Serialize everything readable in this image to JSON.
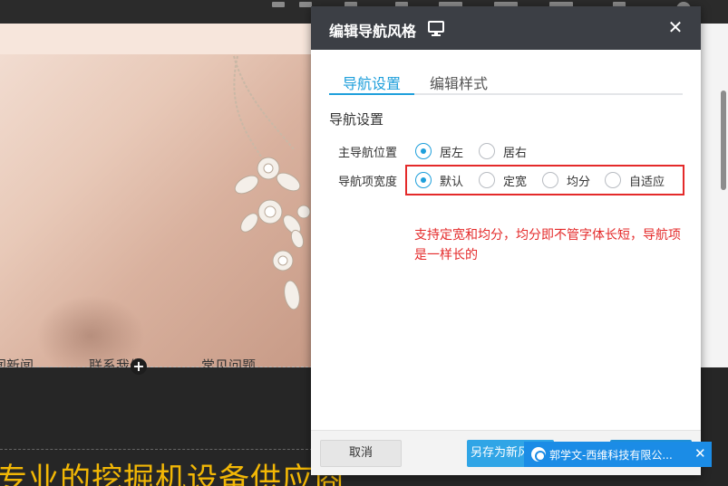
{
  "website": {
    "nav_items": [
      "闻新闻",
      "联系我们",
      "常见问题"
    ],
    "add_symbol": "+",
    "slogan": "专业的挖掘机设备供应商"
  },
  "modal": {
    "title": "编辑导航风格",
    "close_symbol": "✕",
    "tabs": [
      {
        "label": "导航设置",
        "active": true
      },
      {
        "label": "编辑样式",
        "active": false
      }
    ],
    "section_title": "导航设置",
    "position_row": {
      "label": "主导航位置",
      "options": [
        {
          "label": "居左",
          "selected": true
        },
        {
          "label": "居右",
          "selected": false
        }
      ]
    },
    "width_row": {
      "label": "导航项宽度",
      "options": [
        {
          "label": "默认",
          "selected": true
        },
        {
          "label": "定宽",
          "selected": false
        },
        {
          "label": "均分",
          "selected": false
        },
        {
          "label": "自适应",
          "selected": false
        }
      ]
    },
    "annotation": "支持定宽和均分，均分即不管字体长短，导航项是一样长的",
    "footer": {
      "cancel_label": "取消",
      "save_as_label": "另存为新风格",
      "confirm_label": ""
    }
  },
  "notification": {
    "text": "郭学文-西维科技有限公...",
    "close_symbol": "✕"
  },
  "colors": {
    "accent": "#1e9fdb",
    "annotation_red": "#e42a2a",
    "header_dark": "#3c3f45",
    "slogan_yellow": "#f2b705"
  },
  "icons": [
    "monitor-icon",
    "close-icon",
    "plus-icon",
    "notification-app-icon",
    "radio-icon"
  ]
}
